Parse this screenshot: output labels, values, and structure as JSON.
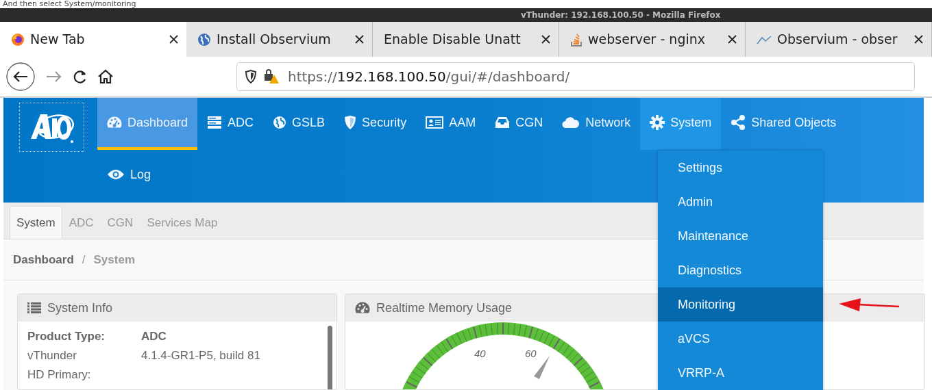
{
  "caption": "And then select System/monitoring",
  "window": {
    "title": "vThunder: 192.168.100.50 - Mozilla Firefox"
  },
  "browser_tabs": [
    {
      "title": "New Tab",
      "kind": "firefox",
      "selected": true
    },
    {
      "title": "Install Observium",
      "kind": "globe",
      "selected": false
    },
    {
      "title": "Enable Disable Unatt",
      "kind": "plain",
      "selected": false
    },
    {
      "title": "webserver - nginx",
      "kind": "stack",
      "selected": false
    },
    {
      "title": "Observium - obser",
      "kind": "wave",
      "selected": false
    }
  ],
  "url": {
    "scheme": "https://",
    "host": "192.168.100.50",
    "path": "/gui/#/dashboard/"
  },
  "nav_rows": [
    [
      {
        "label": "Dashboard",
        "kind": "dashboard",
        "selected": true,
        "expanded": false
      },
      {
        "label": "ADC",
        "kind": "server",
        "selected": false,
        "expanded": false
      },
      {
        "label": "GSLB",
        "kind": "globe",
        "selected": false,
        "expanded": false
      },
      {
        "label": "Security",
        "kind": "shield",
        "selected": false,
        "expanded": false
      },
      {
        "label": "AAM",
        "kind": "idcard",
        "selected": false,
        "expanded": false
      },
      {
        "label": "CGN",
        "kind": "inbox",
        "selected": false,
        "expanded": false
      },
      {
        "label": "Network",
        "kind": "cloud",
        "selected": false,
        "expanded": false
      },
      {
        "label": "System",
        "kind": "gear",
        "selected": false,
        "expanded": true
      },
      {
        "label": "Shared Objects",
        "kind": "share",
        "selected": false,
        "expanded": false
      }
    ],
    [
      {
        "label": "Log",
        "kind": "eye",
        "selected": false,
        "expanded": false
      }
    ]
  ],
  "dropdown": [
    {
      "label": "Settings",
      "selected": false
    },
    {
      "label": "Admin",
      "selected": false
    },
    {
      "label": "Maintenance",
      "selected": false
    },
    {
      "label": "Diagnostics",
      "selected": false
    },
    {
      "label": "Monitoring",
      "selected": true
    },
    {
      "label": "aVCS",
      "selected": false
    },
    {
      "label": "VRRP-A",
      "selected": false
    }
  ],
  "page_tabs": [
    {
      "label": "System",
      "selected": true
    },
    {
      "label": "ADC",
      "selected": false
    },
    {
      "label": "CGN",
      "selected": false
    },
    {
      "label": "Services Map",
      "selected": false
    }
  ],
  "breadcrumb": {
    "separator": "/",
    "items": [
      "Dashboard",
      "System"
    ]
  },
  "panels": [
    {
      "title": "System Info",
      "kind": "list",
      "rows": [
        {
          "label": "Product Type:",
          "value": "ADC",
          "bold": true
        },
        {
          "label": "vThunder",
          "value": "4.1.4-GR1-P5, build 81",
          "bold": false
        },
        {
          "label": "HD Primary:",
          "bold": false
        }
      ]
    },
    {
      "title": "Realtime Memory Usage",
      "kind": "dashboard",
      "gauge_labels": [
        "40",
        "60"
      ]
    }
  ]
}
